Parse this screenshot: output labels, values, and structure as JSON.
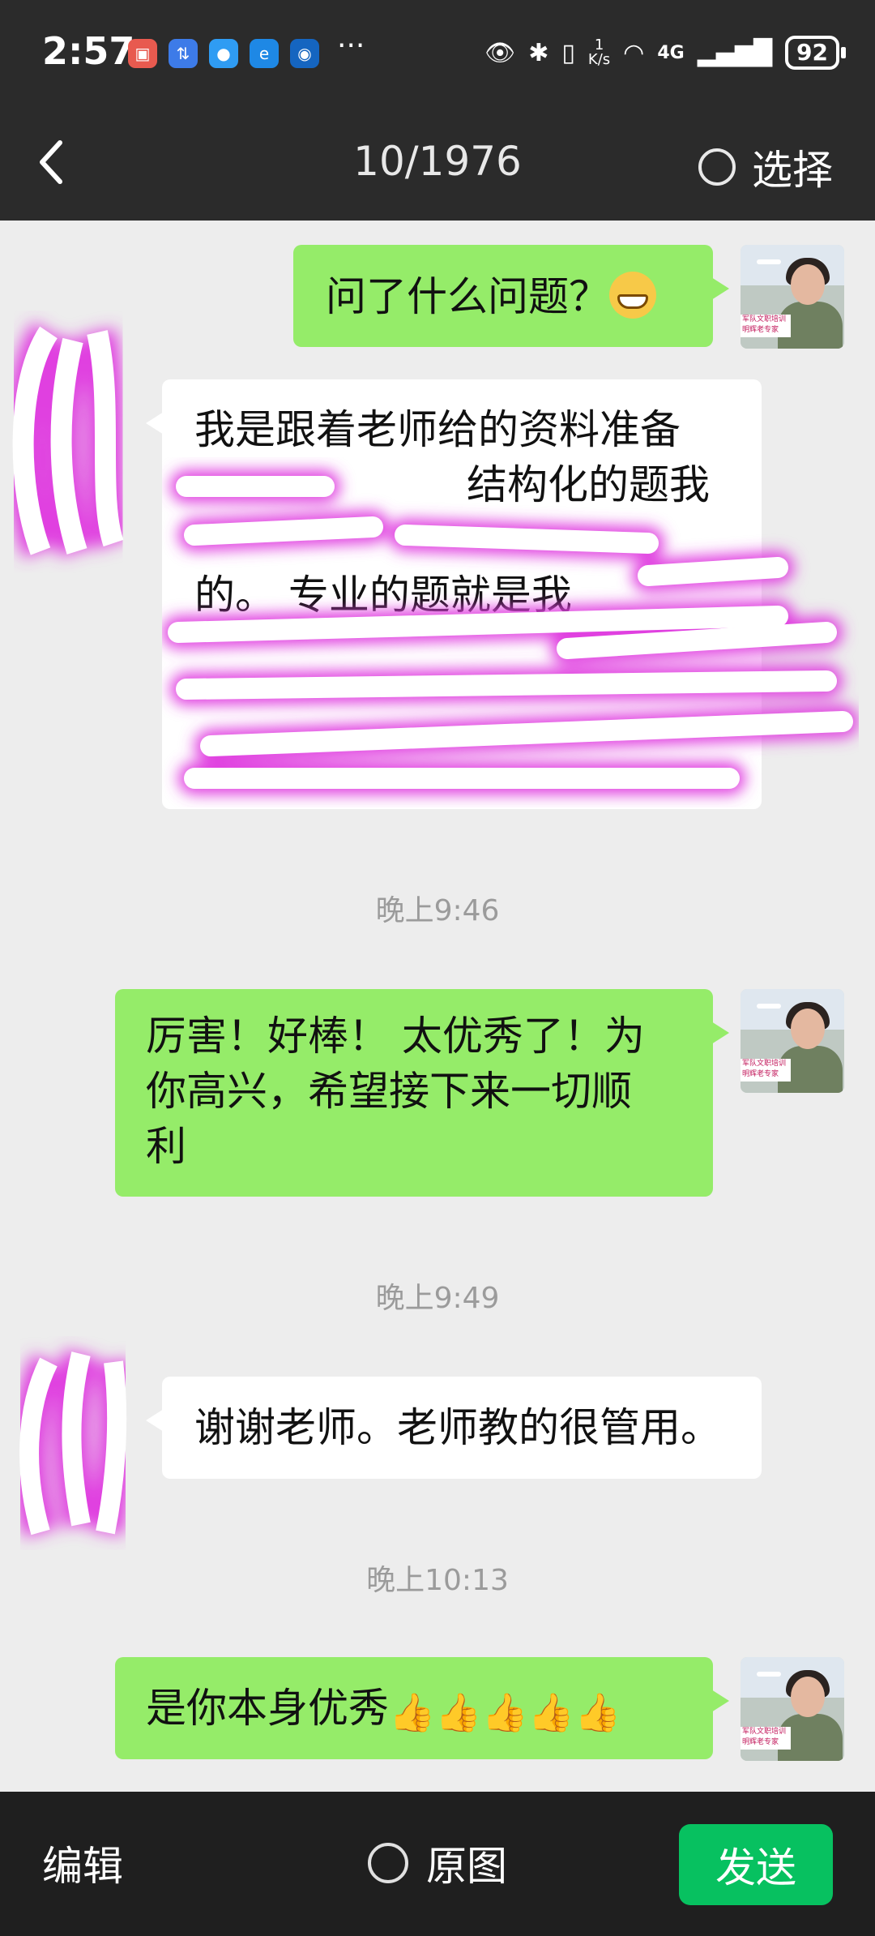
{
  "status_bar": {
    "time": "2:57",
    "more": "···",
    "net_speed_value": "1",
    "net_speed_unit": "K/s",
    "network": "4G",
    "battery": "92"
  },
  "header": {
    "counter": "10/1976",
    "select_label": "选择"
  },
  "messages": [
    {
      "from": "me",
      "text": "问了什么问题？"
    },
    {
      "from": "them",
      "text_lines": [
        "我是跟着老师给的资料准备",
        "结构化的题我",
        "的。  专业的题就是我"
      ]
    },
    {
      "timestamp": "晚上9:46"
    },
    {
      "from": "me",
      "text_lines": [
        "厉害！好棒！ 太优秀了！为",
        "你高兴，希望接下来一切顺",
        "利"
      ]
    },
    {
      "timestamp": "晚上9:49"
    },
    {
      "from": "them",
      "text": "谢谢老师。老师教的很管用。"
    },
    {
      "timestamp": "晚上10:13"
    },
    {
      "from": "me",
      "text": "是你本身优秀"
    }
  ],
  "avatar_caption": [
    "军队文职培训",
    "明辉老专家"
  ],
  "bottom_bar": {
    "edit_label": "编辑",
    "original_label": "原图",
    "send_label": "发送"
  },
  "colors": {
    "my_bubble": "#95ec69",
    "their_bubble": "#ffffff",
    "send_button": "#07c160",
    "bar_dark": "#2b2b2b"
  }
}
